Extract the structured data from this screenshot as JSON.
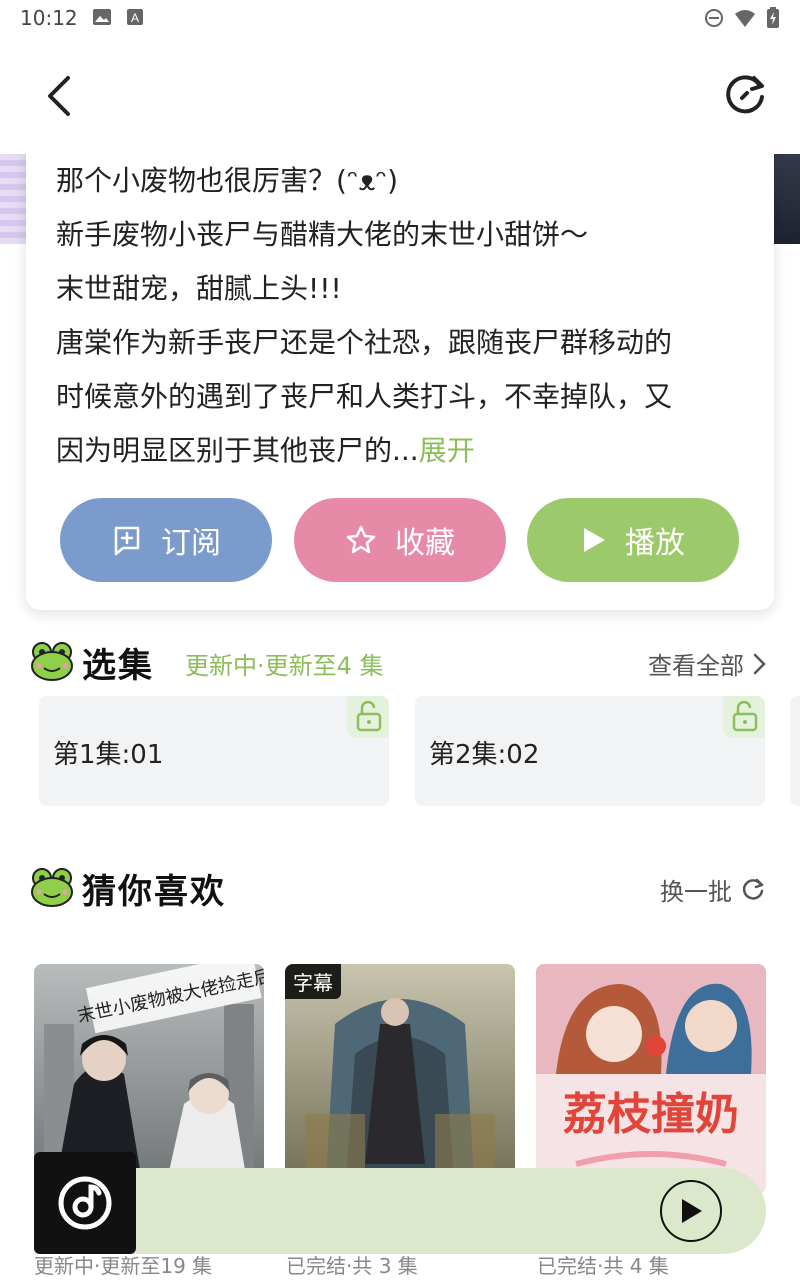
{
  "status": {
    "time": "10:12",
    "left_icons": [
      "image-icon",
      "text-a-icon"
    ],
    "right_icons": [
      "dnd-icon",
      "wifi-icon",
      "battery-icon"
    ]
  },
  "topbar": {
    "back_icon": "chevron-left-icon",
    "refresh_icon": "refresh-icon"
  },
  "description": {
    "lines": [
      "那个小废物也很厉害？(ᵔᴥᵔ)",
      "新手废物小丧尸与醋精大佬的末世小甜饼～",
      "末世甜宠，甜腻上头!!!",
      "唐棠作为新手丧尸还是个社恐，跟随丧尸群移动的",
      "时候意外的遇到了丧尸和人类打斗，不幸掉队，又",
      "因为明显区别于其他丧尸的..."
    ],
    "expand_label": "展开"
  },
  "actions": {
    "subscribe": "订阅",
    "collect": "收藏",
    "play": "播放"
  },
  "episodes_section": {
    "title": "选集",
    "status": "更新中·更新至4 集",
    "more_label": "查看全部",
    "items": [
      {
        "label": "第1集:01"
      },
      {
        "label": "第2集:02"
      }
    ]
  },
  "recommend_section": {
    "title": "猜你喜欢",
    "refresh_label": "换一批",
    "items": [
      {
        "cover_title": "末世小废物被大佬捡走后",
        "meta": "更新中·更新至19 集",
        "badge": ""
      },
      {
        "cover_title": "",
        "meta": "已完结·共 3 集",
        "badge": "字幕"
      },
      {
        "cover_title": "荔枝撞奶",
        "meta": "已完结·共 4 集",
        "badge": ""
      }
    ]
  },
  "player": {
    "logo_icon": "music-disc-icon",
    "play_icon": "play-icon"
  },
  "colors": {
    "accent_green": "#8cbe5a",
    "subscribe_blue": "#7b9bcd",
    "collect_pink": "#e78aa8",
    "play_green": "#9cc96a",
    "player_bg": "#dbe8cc"
  }
}
